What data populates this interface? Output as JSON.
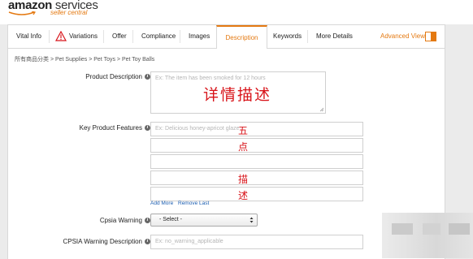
{
  "header": {
    "logo_brand": "amazon",
    "logo_services": " services",
    "logo_sub": "seller central"
  },
  "tabs": [
    {
      "label": "Vital Info"
    },
    {
      "label": "Variations"
    },
    {
      "label": "Offer"
    },
    {
      "label": "Compliance"
    },
    {
      "label": "Images"
    },
    {
      "label": "Description",
      "active": true
    },
    {
      "label": "Keywords"
    },
    {
      "label": "More Details"
    }
  ],
  "advanced_view": {
    "label": "Advanced View"
  },
  "breadcrumb": "所有商品分类 > Pet Supplies > Pet Toys > Pet Toy Balls",
  "info_icon_glyph": "i",
  "product_description": {
    "label": "Product Description",
    "placeholder": "Ex: The item has been smoked for 12 hours",
    "overlay": "详情描述"
  },
  "key_features": {
    "label": "Key Product Features",
    "placeholder": "Ex: Delicious honey-apricot glaze",
    "overlay_chars": [
      "五",
      "点",
      "描",
      "述"
    ],
    "add_more": "Add More",
    "remove_last": "Remove Last"
  },
  "cpsia_warning": {
    "label": "Cpsia Warning",
    "selected": "- Select -"
  },
  "cpsia_description": {
    "label": "CPSIA Warning Description",
    "placeholder": "Ex: no_warning_applicable"
  },
  "colors": {
    "accent": "#e47911",
    "overlay_red": "#d8141a",
    "link_blue": "#1a5db1"
  },
  "icons": [
    "warning-icon",
    "info-icon",
    "dropdown-arrow-icon",
    "toggle-icon",
    "resize-handle-icon"
  ]
}
